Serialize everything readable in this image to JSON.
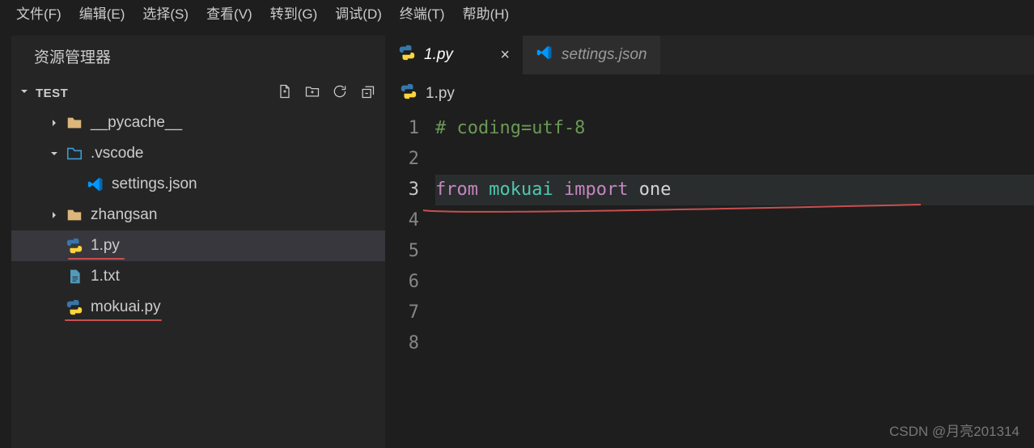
{
  "menubar": [
    "文件(F)",
    "编辑(E)",
    "选择(S)",
    "查看(V)",
    "转到(G)",
    "调试(D)",
    "终端(T)",
    "帮助(H)"
  ],
  "sidebar": {
    "title": "资源管理器",
    "section": "TEST",
    "tree": [
      {
        "label": "__pycache__",
        "type": "folder",
        "expanded": false,
        "depth": 1
      },
      {
        "label": ".vscode",
        "type": "folder-vscode",
        "expanded": true,
        "depth": 1
      },
      {
        "label": "settings.json",
        "type": "vscode-json",
        "depth": 2
      },
      {
        "label": "zhangsan",
        "type": "folder",
        "expanded": false,
        "depth": 1
      },
      {
        "label": "1.py",
        "type": "python",
        "depth": 1,
        "selected": true,
        "underline": true
      },
      {
        "label": "1.txt",
        "type": "txt",
        "depth": 1
      },
      {
        "label": "mokuai.py",
        "type": "python",
        "depth": 1,
        "underline": true
      }
    ]
  },
  "tabs": [
    {
      "label": "1.py",
      "type": "python",
      "active": true,
      "closeable": true
    },
    {
      "label": "settings.json",
      "type": "vscode-json",
      "active": false,
      "closeable": false
    }
  ],
  "breadcrumb": {
    "label": "1.py",
    "type": "python"
  },
  "code": {
    "lines": [
      "1",
      "2",
      "3",
      "4",
      "5",
      "6",
      "7",
      "8"
    ],
    "line1_comment": "# coding=utf-8",
    "line3": {
      "kw_from": "from",
      "module": "mokuai",
      "kw_import": "import",
      "ident": "one"
    }
  },
  "watermark": "CSDN @月亮201314"
}
